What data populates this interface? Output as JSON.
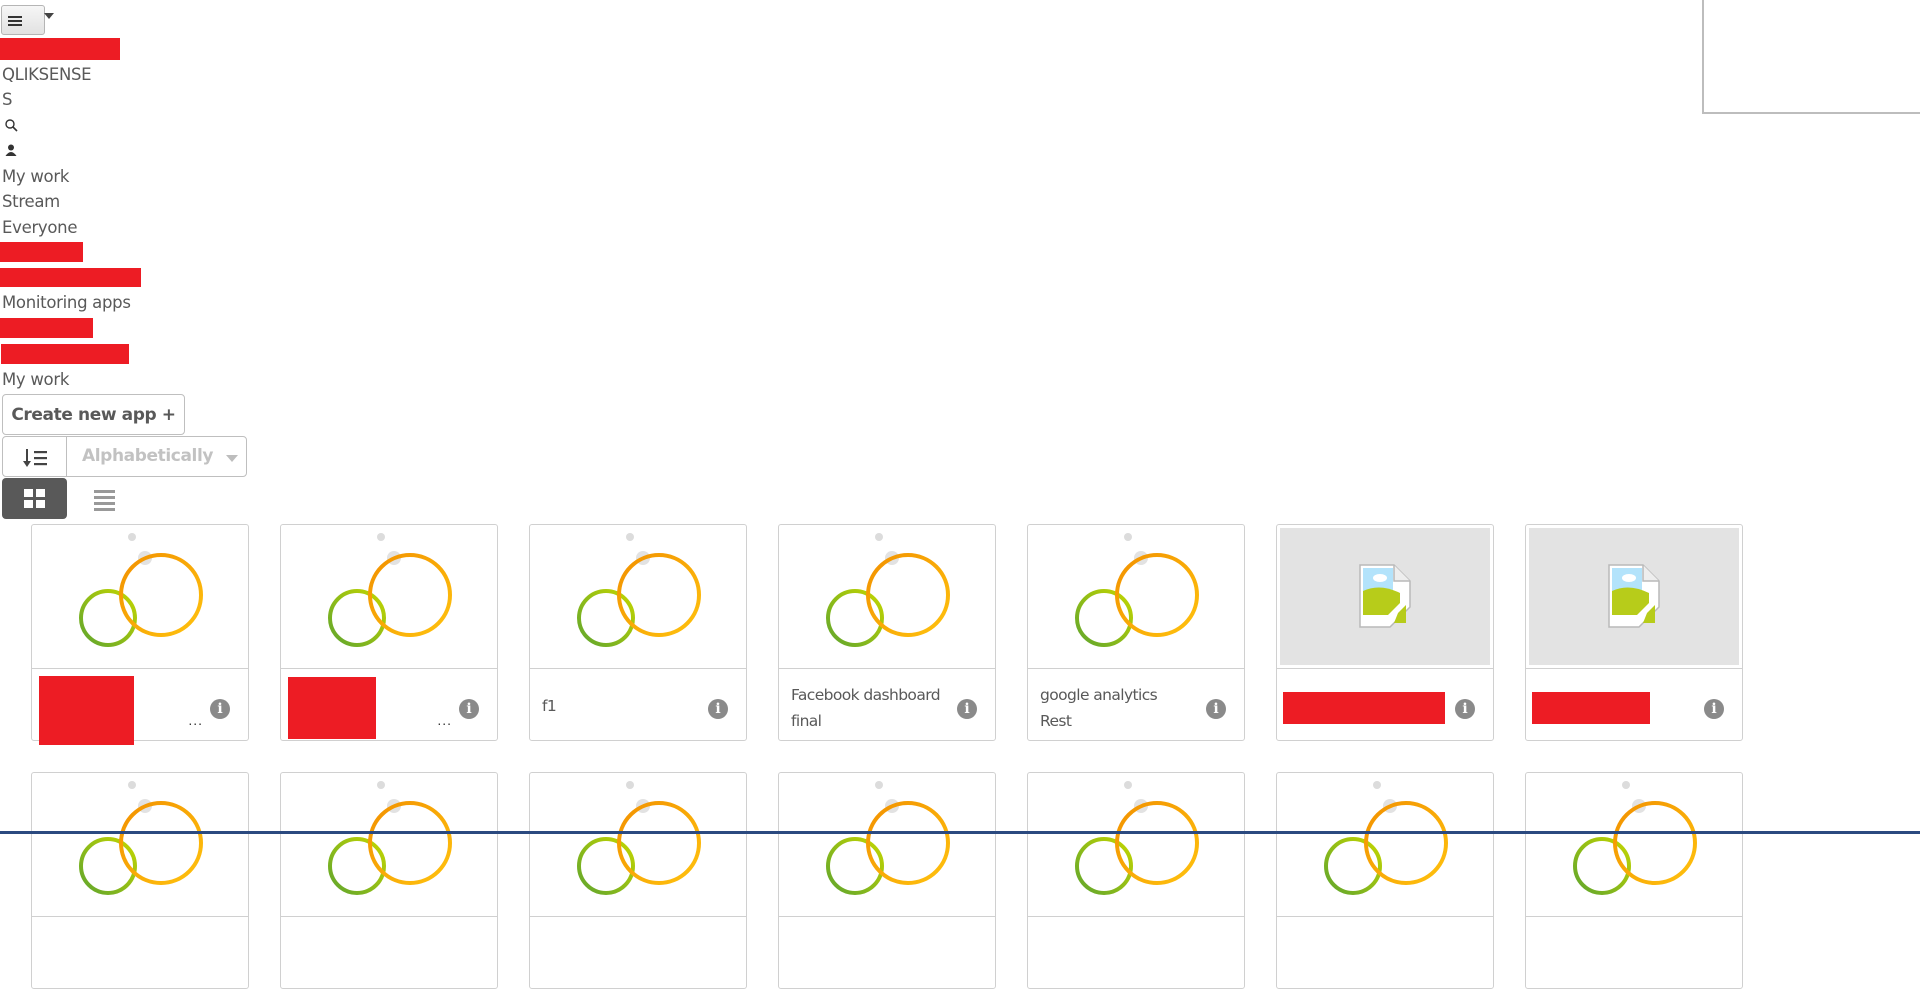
{
  "top_menu": {
    "icon": "hamburger-icon",
    "dropdown_icon": "caret-down-icon"
  },
  "header": {
    "product_label": "QLIKSENSE",
    "product_label_secondary": "S",
    "search_icon": "search-icon",
    "user_icon": "user-icon"
  },
  "sidebar": {
    "items": [
      {
        "label": "My work"
      },
      {
        "label": "Stream"
      },
      {
        "label": "Everyone"
      },
      {
        "label": "[redacted]",
        "redacted": true
      },
      {
        "label": "[redacted]",
        "redacted": true
      },
      {
        "label": "Monitoring apps"
      },
      {
        "label": "[redacted]",
        "redacted": true
      },
      {
        "label": "[redacted]",
        "redacted": true
      }
    ],
    "section_title": "My work"
  },
  "toolbar": {
    "create_label": "Create new app +",
    "sort_order_icon": "sort-ascending-icon",
    "sort_value": "Alphabetically",
    "view_modes": [
      {
        "name": "grid",
        "icon": "grid-view-icon",
        "active": true
      },
      {
        "name": "list",
        "icon": "list-view-icon",
        "active": false
      }
    ]
  },
  "colors": {
    "redaction": "#ed1c24",
    "active_toggle": "#595959",
    "text": "#595959",
    "logo_green": "#7cb82f",
    "logo_orange": "#f5a20a"
  },
  "apps": [
    {
      "title": "[redacted]",
      "redacted": true,
      "thumbnail": "qlik-logo",
      "truncated": true,
      "ellipsis": "..."
    },
    {
      "title": "[redacted]",
      "redacted": true,
      "thumbnail": "qlik-logo",
      "truncated": true,
      "ellipsis": "..."
    },
    {
      "title": "f1",
      "redacted": false,
      "thumbnail": "qlik-logo"
    },
    {
      "title": "Facebook dashboard final",
      "redacted": false,
      "thumbnail": "qlik-logo"
    },
    {
      "title": "google analytics Rest",
      "redacted": false,
      "thumbnail": "qlik-logo"
    },
    {
      "title": "[redacted]",
      "redacted": true,
      "thumbnail": "broken-image"
    },
    {
      "title": "[redacted]",
      "redacted": true,
      "thumbnail": "broken-image"
    }
  ],
  "apps_row2_count": 7,
  "info_glyph": "i"
}
